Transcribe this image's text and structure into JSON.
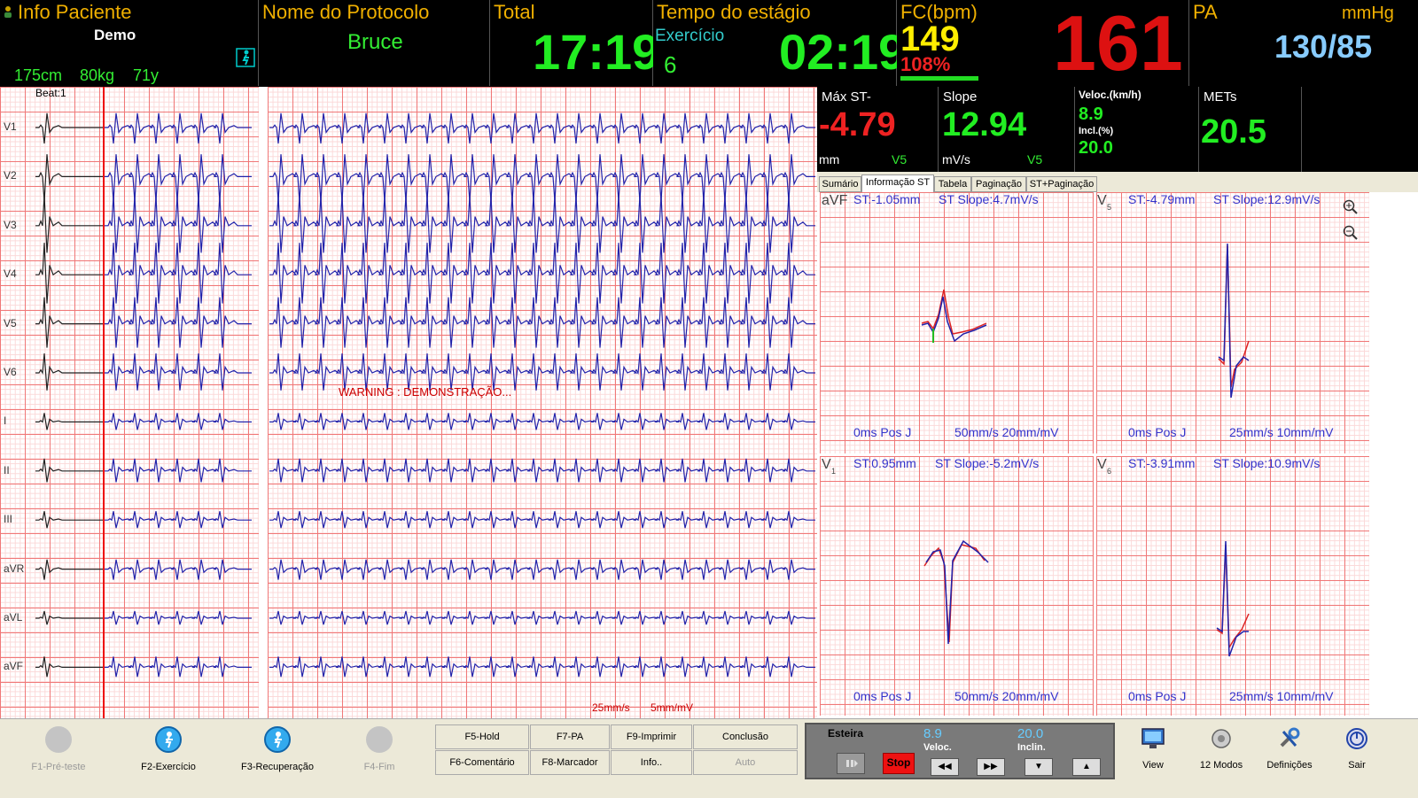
{
  "header": {
    "patient": {
      "label": "Info Paciente",
      "name": "Demo",
      "height": "175cm",
      "weight": "80kg",
      "age": "71y"
    },
    "protocol": {
      "label": "Nome do Protocolo",
      "name": "Bruce"
    },
    "total": {
      "label": "Total",
      "time": "17:19"
    },
    "stage": {
      "label": "Tempo do estágio",
      "phase": "Exercício",
      "number": "6",
      "time": "02:19"
    },
    "hr": {
      "label": "FC(bpm)",
      "value": "149",
      "percent": "108%",
      "big": "161"
    },
    "bp": {
      "label": "PA",
      "unit": "mmHg",
      "value": "130/85"
    }
  },
  "ecg": {
    "beat_label": "Beat:1",
    "leads": [
      "V1",
      "V2",
      "V3",
      "V4",
      "V5",
      "V6",
      "I",
      "II",
      "III",
      "aVR",
      "aVL",
      "aVF"
    ],
    "warning": "WARNING : DEMONSTRAÇÃO...",
    "speed": "25mm/s",
    "gain": "5mm/mV"
  },
  "metrics": {
    "max_st": {
      "label": "Máx ST-",
      "value": "-4.79",
      "unit": "mm",
      "lead": "V5"
    },
    "slope": {
      "label": "Slope",
      "value": "12.94",
      "unit": "mV/s",
      "lead": "V5"
    },
    "speed": {
      "label": "Veloc.(km/h)",
      "value": "8.9",
      "incl_label": "Incl.(%)",
      "incl_value": "20.0"
    },
    "mets": {
      "label": "METs",
      "value": "20.5"
    }
  },
  "tabs": [
    "Sumário",
    "Informação ST",
    "Tabela",
    "Paginação",
    "ST+Paginação"
  ],
  "st_panels": [
    {
      "lead": "aVF",
      "sub": "",
      "st": "ST:-1.05mm",
      "slope": "ST Slope:4.7mV/s",
      "pos": "0ms Pos J",
      "scale": "50mm/s 20mm/mV"
    },
    {
      "lead": "V",
      "sub": "5",
      "st": "ST:-4.79mm",
      "slope": "ST Slope:12.9mV/s",
      "pos": "0ms Pos J",
      "scale": "25mm/s 10mm/mV"
    },
    {
      "lead": "V",
      "sub": "1",
      "st": "ST:0.95mm",
      "slope": "ST Slope:-5.2mV/s",
      "pos": "0ms Pos J",
      "scale": "50mm/s 20mm/mV"
    },
    {
      "lead": "V",
      "sub": "6",
      "st": "ST:-3.91mm",
      "slope": "ST Slope:10.9mV/s",
      "pos": "0ms Pos J",
      "scale": "25mm/s 10mm/mV"
    }
  ],
  "bottom": {
    "stages": [
      {
        "label": "F1-Pré-teste",
        "enabled": false
      },
      {
        "label": "F2-Exercício",
        "enabled": true
      },
      {
        "label": "F3-Recuperação",
        "enabled": true
      },
      {
        "label": "F4-Fim",
        "enabled": false
      }
    ],
    "buttons": [
      "F5-Hold",
      "F7-PA",
      "F9-Imprimir",
      "Conclusão",
      "F6-Comentário",
      "F8-Marcador",
      "Info..",
      "Auto"
    ],
    "treadmill": {
      "title": "Esteira",
      "speed_value": "8.9",
      "speed_label": "Veloc.",
      "incl_value": "20.0",
      "incl_label": "Inclin.",
      "stop": "Stop"
    },
    "tools": [
      "View",
      "12 Modos",
      "Definições",
      "Sair"
    ]
  },
  "colors": {
    "accent_orange": "#f0b000",
    "green": "#22ee22",
    "red": "#dd1111",
    "cyan": "#66ccff",
    "yellow": "#ffee00",
    "trace_blue": "#2222aa"
  }
}
